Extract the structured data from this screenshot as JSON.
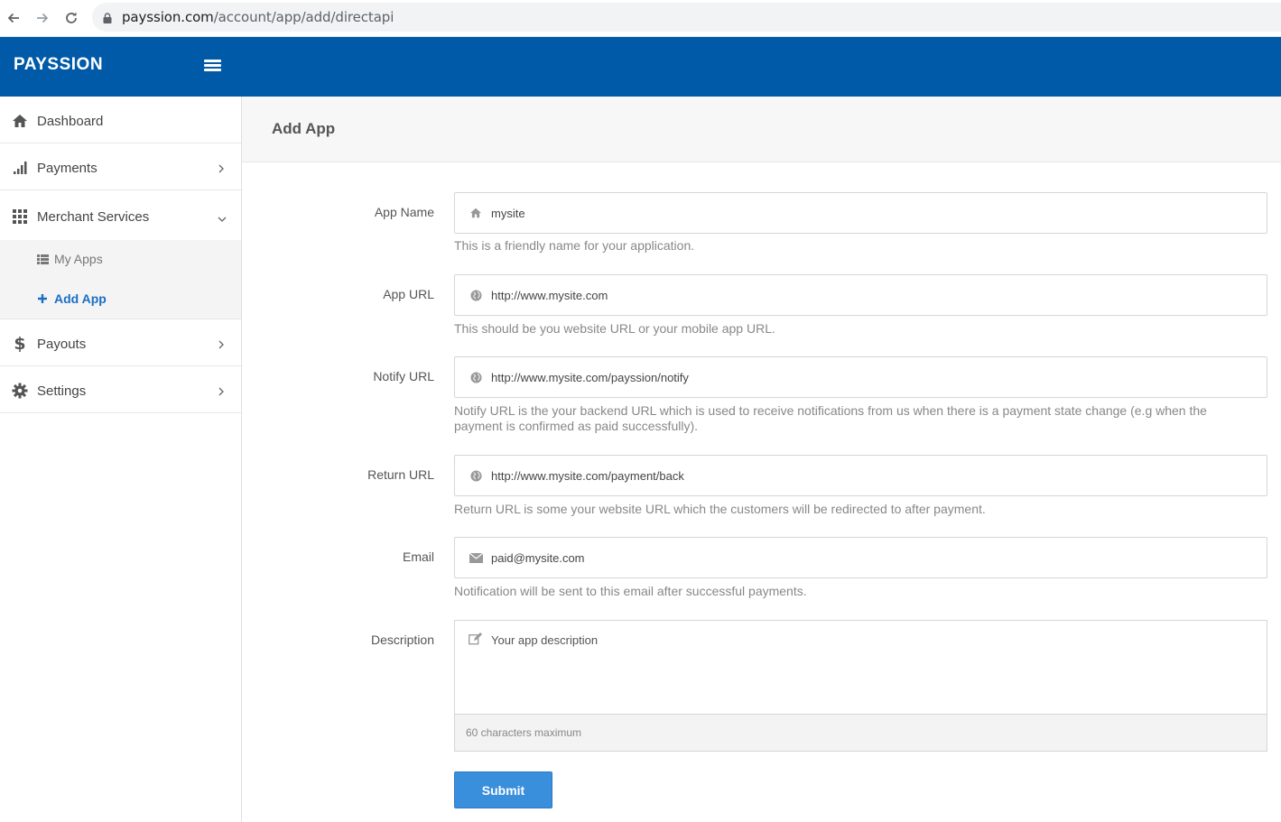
{
  "browser": {
    "url_host": "payssion.com",
    "url_path": "/account/app/add/directapi"
  },
  "header": {
    "brand": "PAYSSION"
  },
  "sidebar": {
    "items": [
      {
        "label": "Dashboard",
        "icon": "home-icon"
      },
      {
        "label": "Payments",
        "icon": "signal-bars-icon"
      },
      {
        "label": "Merchant Services",
        "icon": "grid-icon"
      },
      {
        "label": "Payouts",
        "icon": "dollar-icon"
      },
      {
        "label": "Settings",
        "icon": "gear-icon"
      }
    ],
    "submenu": [
      {
        "label": "My Apps",
        "icon": "list-icon"
      },
      {
        "label": "Add App",
        "icon": "plus-icon",
        "active": true
      }
    ]
  },
  "page": {
    "title": "Add App"
  },
  "form": {
    "app_name": {
      "label": "App Name",
      "value": "mysite",
      "help": "This is a friendly name for your application.",
      "icon": "home-icon"
    },
    "app_url": {
      "label": "App URL",
      "value": "http://www.mysite.com",
      "help": "This should be you website URL or your mobile app URL.",
      "icon": "globe-icon"
    },
    "notify_url": {
      "label": "Notify URL",
      "value": "http://www.mysite.com/payssion/notify",
      "help": "Notify URL is the your backend URL which is used to receive notifications from us when there is a payment state change (e.g when the payment is confirmed as paid successfully).",
      "icon": "globe-icon"
    },
    "return_url": {
      "label": "Return URL",
      "value": "http://www.mysite.com/payment/back",
      "help": "Return URL is some your website URL which the customers will be redirected to after payment.",
      "icon": "globe-icon"
    },
    "email": {
      "label": "Email",
      "value": "paid@mysite.com",
      "help": "Notification will be sent to this email after successful payments.",
      "icon": "envelope-icon"
    },
    "description": {
      "label": "Description",
      "placeholder": "Your app description",
      "footer": "60 characters maximum",
      "icon": "edit-icon"
    },
    "submit_label": "Submit"
  },
  "colors": {
    "brand_blue": "#005aa8",
    "submit_blue": "#3a8fdc",
    "active_link": "#1a6fc4"
  }
}
